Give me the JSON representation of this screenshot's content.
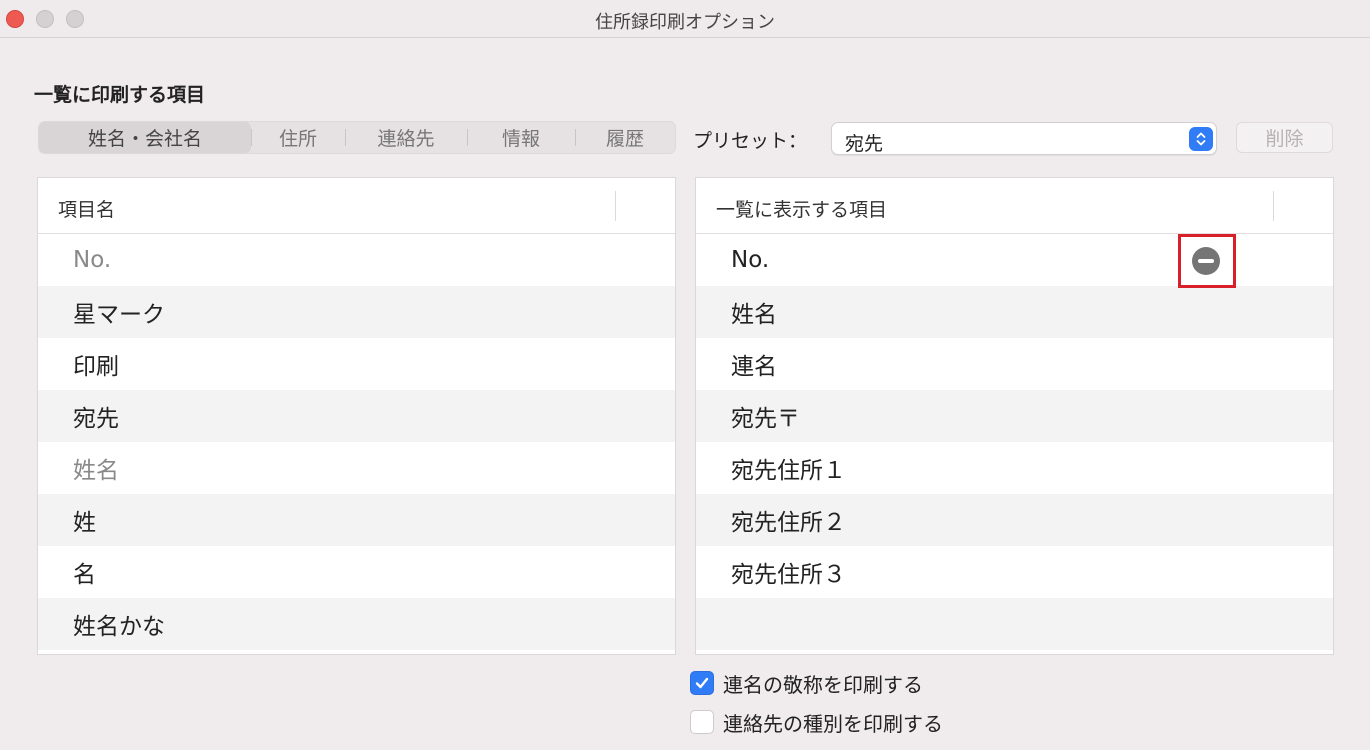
{
  "window": {
    "title": "住所録印刷オプション"
  },
  "section": {
    "title": "一覧に印刷する項目"
  },
  "tabs": [
    {
      "label": "姓名・会社名",
      "active": true
    },
    {
      "label": "住所",
      "active": false
    },
    {
      "label": "連絡先",
      "active": false
    },
    {
      "label": "情報",
      "active": false
    },
    {
      "label": "履歴",
      "active": false
    }
  ],
  "preset": {
    "label": "プリセット：",
    "value": "宛先",
    "delete_label": "削除"
  },
  "left_table": {
    "header": "項目名",
    "rows": [
      {
        "label": "No.",
        "disabled": true
      },
      {
        "label": "星マーク",
        "disabled": false
      },
      {
        "label": "印刷",
        "disabled": false
      },
      {
        "label": "宛先",
        "disabled": false
      },
      {
        "label": "姓名",
        "disabled": true
      },
      {
        "label": "姓",
        "disabled": false
      },
      {
        "label": "名",
        "disabled": false
      },
      {
        "label": "姓名かな",
        "disabled": false
      }
    ]
  },
  "right_table": {
    "header": "一覧に表示する項目",
    "rows": [
      {
        "label": "No."
      },
      {
        "label": "姓名"
      },
      {
        "label": "連名"
      },
      {
        "label": "宛先〒"
      },
      {
        "label": "宛先住所１"
      },
      {
        "label": "宛先住所２"
      },
      {
        "label": "宛先住所３"
      },
      {
        "label": ""
      }
    ]
  },
  "options": [
    {
      "label": "連名の敬称を印刷する",
      "checked": true
    },
    {
      "label": "連絡先の種別を印刷する",
      "checked": false
    }
  ],
  "colors": {
    "accent": "#2f7cf6",
    "highlight": "#d7202a",
    "close": "#ee5a52"
  }
}
